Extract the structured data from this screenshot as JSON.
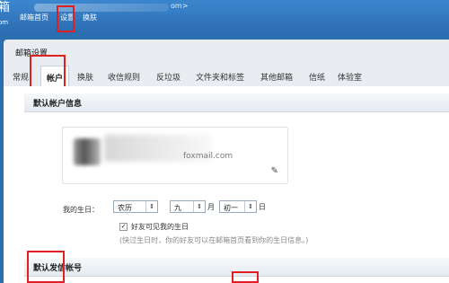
{
  "header": {
    "brand": "箱",
    "brand_sub": "om",
    "email_tail": "om>",
    "nav": [
      "邮箱首页",
      "设置",
      "换肤"
    ]
  },
  "panel": {
    "title": "邮箱设置"
  },
  "tabs": [
    "常规",
    "帐户",
    "换肤",
    "收信规则",
    "反垃圾",
    "文件夹和标签",
    "其他邮箱",
    "信纸",
    "体验室"
  ],
  "active_tab": "帐户",
  "account": {
    "section_title": "默认帐户信息",
    "email_suffix": "foxmail.com",
    "birthday_label": "我的生日：",
    "calendar": "农历",
    "month": "九",
    "month_unit": "月",
    "day": "初一",
    "day_unit": "日",
    "friends_visible_label": "好友可见我的生日",
    "friends_visible_checked": true,
    "hint": "(快过生日时，你的好友可以在邮箱首页看到你的生日信息。)"
  },
  "sender": {
    "section_title": "默认发信帐号"
  },
  "colors": {
    "highlight": "#e02020",
    "accent": "#2c6fb0"
  }
}
